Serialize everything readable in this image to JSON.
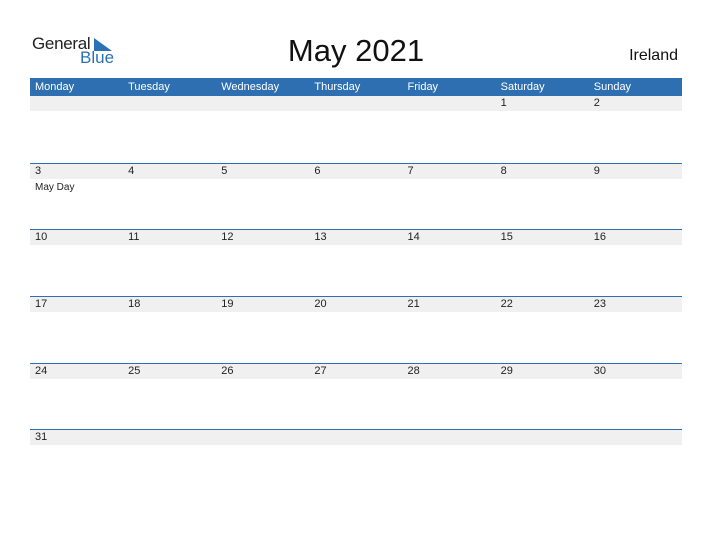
{
  "logo": {
    "general": "General",
    "blue": "Blue"
  },
  "title": "May 2021",
  "country": "Ireland",
  "colors": {
    "accent": "#2e6fb1",
    "band": "#f0f0f0"
  },
  "weekdays": [
    "Monday",
    "Tuesday",
    "Wednesday",
    "Thursday",
    "Friday",
    "Saturday",
    "Sunday"
  ],
  "weeks": [
    [
      {
        "day": ""
      },
      {
        "day": ""
      },
      {
        "day": ""
      },
      {
        "day": ""
      },
      {
        "day": ""
      },
      {
        "day": "1"
      },
      {
        "day": "2"
      }
    ],
    [
      {
        "day": "3",
        "holiday": "May Day"
      },
      {
        "day": "4"
      },
      {
        "day": "5"
      },
      {
        "day": "6"
      },
      {
        "day": "7"
      },
      {
        "day": "8"
      },
      {
        "day": "9"
      }
    ],
    [
      {
        "day": "10"
      },
      {
        "day": "11"
      },
      {
        "day": "12"
      },
      {
        "day": "13"
      },
      {
        "day": "14"
      },
      {
        "day": "15"
      },
      {
        "day": "16"
      }
    ],
    [
      {
        "day": "17"
      },
      {
        "day": "18"
      },
      {
        "day": "19"
      },
      {
        "day": "20"
      },
      {
        "day": "21"
      },
      {
        "day": "22"
      },
      {
        "day": "23"
      }
    ],
    [
      {
        "day": "24"
      },
      {
        "day": "25"
      },
      {
        "day": "26"
      },
      {
        "day": "27"
      },
      {
        "day": "28"
      },
      {
        "day": "29"
      },
      {
        "day": "30"
      }
    ],
    [
      {
        "day": "31"
      },
      {
        "day": ""
      },
      {
        "day": ""
      },
      {
        "day": ""
      },
      {
        "day": ""
      },
      {
        "day": ""
      },
      {
        "day": ""
      }
    ]
  ]
}
